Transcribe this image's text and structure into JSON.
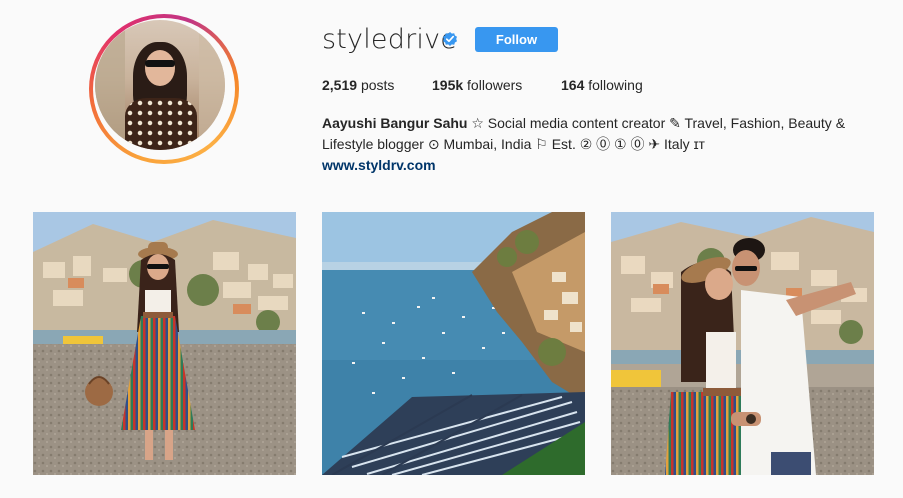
{
  "profile": {
    "username": "styledrive",
    "follow_label": "Follow",
    "verified_icon": "verified-badge-icon",
    "accent_color": "#3897f0"
  },
  "stats": {
    "posts_count": "2,519",
    "posts_label": "posts",
    "followers_count": "195k",
    "followers_label": "followers",
    "following_count": "164",
    "following_label": "following"
  },
  "bio": {
    "name": "Aayushi Bangur Sahu",
    "text": " ☆ Social media content creator ✎ Travel, Fashion, Beauty & Lifestyle blogger ⊙ Mumbai, India ⚐ Est. ② ⓪ ① ⓪ ✈ Italy ɪᴛ",
    "link": "www.styldrv.com"
  },
  "posts": [
    {
      "icon": "post-woman-striped-skirt-beach"
    },
    {
      "icon": "post-coastal-bay-boats"
    },
    {
      "icon": "post-couple-kissing-beach"
    }
  ]
}
